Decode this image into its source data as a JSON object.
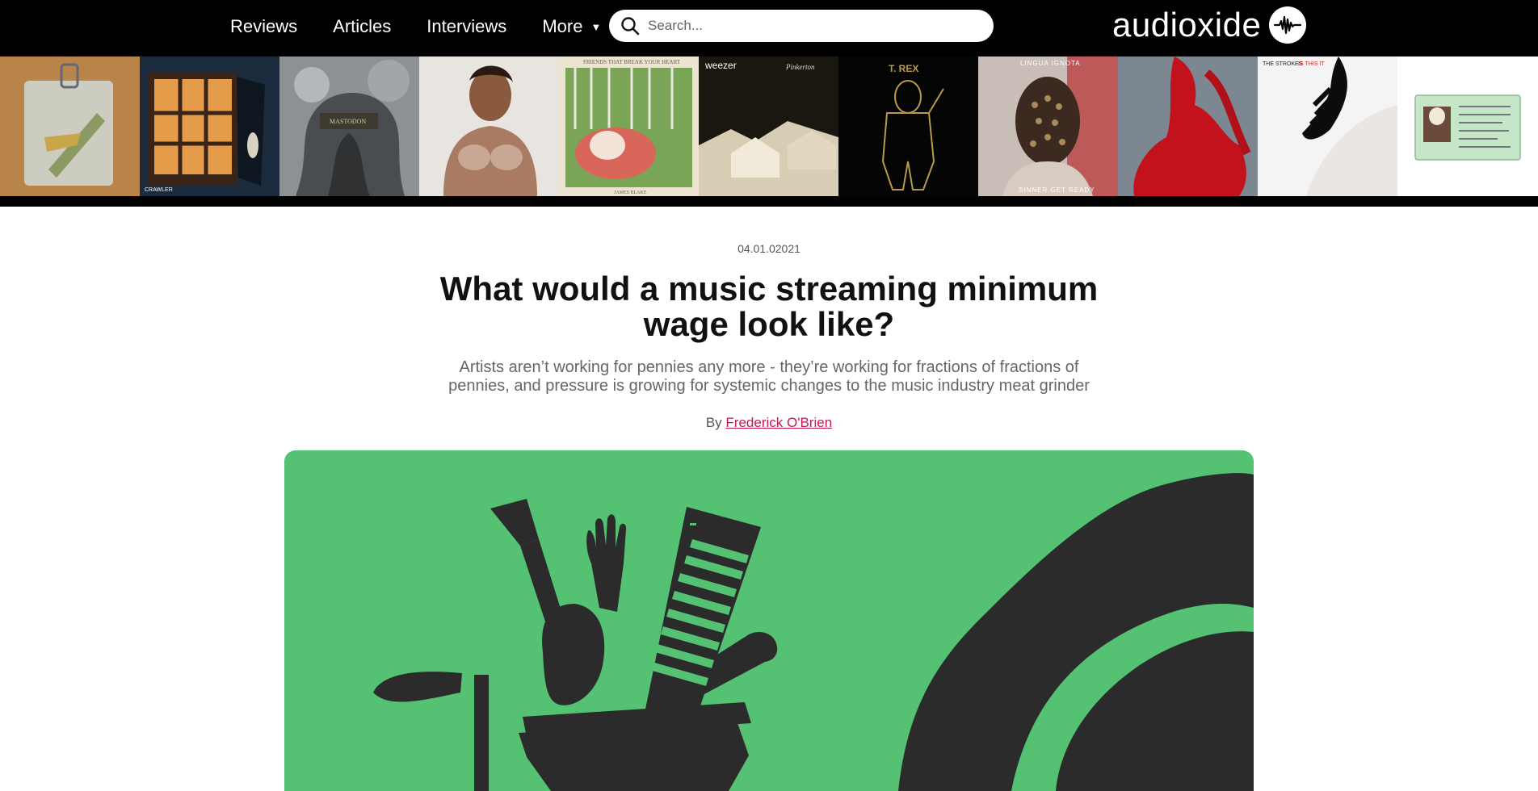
{
  "nav": {
    "items": [
      {
        "label": "Reviews"
      },
      {
        "label": "Articles"
      },
      {
        "label": "Interviews"
      },
      {
        "label": "More"
      }
    ]
  },
  "search": {
    "placeholder": "Search..."
  },
  "brand": {
    "name": "audioxide"
  },
  "covers": [
    {
      "name": "album-cover-bag",
      "text": ""
    },
    {
      "name": "album-cover-crawler",
      "text": "CRAWLER"
    },
    {
      "name": "album-cover-mastodon",
      "text": "MASTODON"
    },
    {
      "name": "album-cover-portrait",
      "text": ""
    },
    {
      "name": "album-cover-friends-that-break-your-heart",
      "text": "FRIENDS THAT BREAK YOUR HEART",
      "text2": "JAMES BLAKE"
    },
    {
      "name": "album-cover-weezer",
      "text": "weezer",
      "text2": "Pinkerton"
    },
    {
      "name": "album-cover-t-rex",
      "text": "T. REX"
    },
    {
      "name": "album-cover-lingua-ignota",
      "text": "LINGUA IGNOTA",
      "text2": "SINNER GET READY"
    },
    {
      "name": "album-cover-red-figure",
      "text": ""
    },
    {
      "name": "album-cover-the-strokes",
      "text": "THE STROKES",
      "text2": "IS THIS IT"
    },
    {
      "name": "album-cover-call-me-if-you-get-lost",
      "text": ""
    }
  ],
  "article": {
    "date": "04.01.02021",
    "title": "What would a music streaming minimum wage look like?",
    "subtitle": "Artists aren’t working for pennies any more - they’re working for fractions of fractions of pennies, and pressure is growing for systemic changes to the music industry meat grinder",
    "byline_prefix": "By",
    "author": "Frederick O'Brien"
  },
  "colors": {
    "topbar": "#000000",
    "accent_link": "#c2185b",
    "hero_green": "#55c173",
    "hero_ink": "#2b2b2b"
  }
}
